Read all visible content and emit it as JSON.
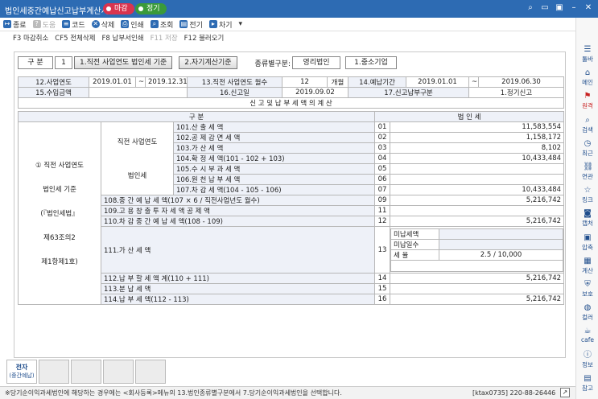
{
  "window": {
    "title": "법인세중간예납신고납부계산서",
    "badge_deadline": "마감",
    "badge_regular": "정기"
  },
  "toolbar": {
    "close": "종료",
    "help": "도움",
    "code": "코드",
    "delete": "삭제",
    "print": "인쇄",
    "search": "조회",
    "efile": "전기",
    "next": "차기"
  },
  "fkeys": {
    "f3": "F3 마감취소",
    "cf5": "CF5 전체삭제",
    "f8": "F8 납부서인쇄",
    "f11": "F11 저장",
    "f12": "F12 불러오기"
  },
  "sidebar": [
    {
      "label": "툴바",
      "icon": "menu-icon"
    },
    {
      "label": "메인",
      "icon": "home-icon"
    },
    {
      "label": "원격",
      "icon": "remote-icon"
    },
    {
      "label": "검색",
      "icon": "search-icon"
    },
    {
      "label": "최근",
      "icon": "clock-icon"
    },
    {
      "label": "연관",
      "icon": "link-icon"
    },
    {
      "label": "링크",
      "icon": "star-icon"
    },
    {
      "label": "캡처",
      "icon": "camera-icon"
    },
    {
      "label": "압축",
      "icon": "compress-icon"
    },
    {
      "label": "계산",
      "icon": "calculator-icon"
    },
    {
      "label": "보호",
      "icon": "shield-icon"
    },
    {
      "label": "컬러",
      "icon": "palette-icon"
    },
    {
      "label": "cafe",
      "icon": "cafe-icon"
    },
    {
      "label": "정보",
      "icon": "info-icon"
    },
    {
      "label": "참고",
      "icon": "book-icon"
    }
  ],
  "header": {
    "gubun_label": "구 분",
    "gubun_value": "1",
    "option1": "1.직전 사업연도 법인세 기준",
    "option2": "2.자기계산기준",
    "corp_type_label": "종류별구분:",
    "corp_type_value": "영리법인",
    "company_size": "1.중소기업"
  },
  "info": {
    "l12": "12.사업연도",
    "fy_start": "2019.01.01",
    "tilde1": "~",
    "fy_end": "2019.12.31",
    "l13": "13.직전 사업연도 월수",
    "months": "12",
    "month_unit": "개월",
    "l14": "14.예납기간",
    "pp_start": "2019.01.01",
    "tilde2": "~",
    "pp_end": "2019.06.30",
    "l15": "15.수입금액",
    "revenue": "",
    "l16": "16.신고일",
    "filed": "2019.09.02",
    "l17": "17.신고납부구분",
    "filing_type": "1.정기신고"
  },
  "section_title": "신 고 및 납 부 세 액 의 계 산",
  "cols": {
    "gubun": "구 분",
    "tax": "법 인 세"
  },
  "left_label": {
    "line1": "① 직전 사업연도",
    "line2": "법인세 기준",
    "line3": "(『법인세법』",
    "line4": "제63조의2",
    "line5": "제1항제1호)"
  },
  "sub_labels": {
    "prev_year": "직전 사업연도",
    "corp_tax": "법인세"
  },
  "rows": [
    {
      "label": "101.산 출 세 액",
      "code": "01",
      "amount": "11,583,554"
    },
    {
      "label": "102.공 제 감 면 세 액",
      "code": "02",
      "amount": "1,158,172"
    },
    {
      "label": "103.가 산 세 액",
      "code": "03",
      "amount": "8,102"
    },
    {
      "label": "104.확 정 세 액(101 - 102 + 103)",
      "code": "04",
      "amount": "10,433,484"
    },
    {
      "label": "105.수 시 부 과 세 액",
      "code": "05",
      "amount": ""
    },
    {
      "label": "106.원 천 납 부 세 액",
      "code": "06",
      "amount": ""
    },
    {
      "label": "107.차 감 세 액(104 - 105 - 106)",
      "code": "07",
      "amount": "10,433,484"
    },
    {
      "label": "108.중 간 예 납 세 액(107 × 6 / 직전사업년도 월수)",
      "code": "09",
      "amount": "5,216,742"
    },
    {
      "label": "109.고 용 창 출 투 자 세 액 공 제 액",
      "code": "11",
      "amount": ""
    },
    {
      "label": "110.차 감 중 간 예 납 세 액(108 - 109)",
      "code": "12",
      "amount": "5,216,742"
    },
    {
      "label": "111.가 산 세 액",
      "code": "13",
      "amount": ""
    },
    {
      "label": "112.납 부 할 세 액 계(110 + 111)",
      "code": "14",
      "amount": "5,216,742"
    },
    {
      "label": "113.분 납 세 액",
      "code": "15",
      "amount": ""
    },
    {
      "label": "114.납 부 세 액(112 - 113)",
      "code": "16",
      "amount": "5,216,742"
    }
  ],
  "penalty": {
    "unpaid_tax": "미납세액",
    "unpaid_days": "미납일수",
    "rate_label": "세 율",
    "rate_value": "2.5 / 10,000"
  },
  "bottom_tab": {
    "line1": "전자",
    "line2": "(중간예납)"
  },
  "status": {
    "message": "※당기순이익과세법인에 해당하는 경우에는 <회사등록>메뉴의 13.법인종류별구분에서 7.당기순이익과세법인을 선택합니다.",
    "ktax": "[ktax0735] 220-88-26446"
  }
}
